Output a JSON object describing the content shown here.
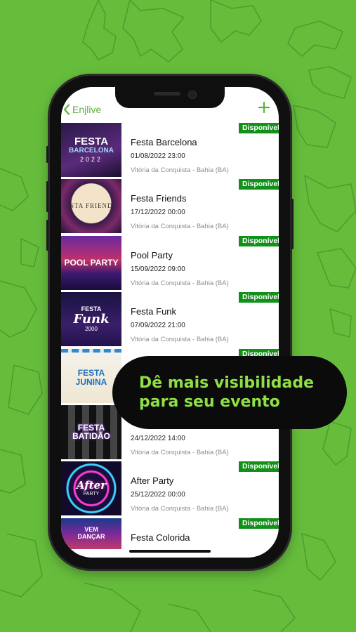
{
  "nav": {
    "back_label": "Enjlive"
  },
  "events": [
    {
      "title": "Festa Barcelona",
      "date": "01/08/2022 23:00",
      "location": "Vitória da Conquista - Bahia (BA)",
      "badge": "Disponível",
      "thumb": [
        "FESTA",
        "BARCELONA",
        "2022"
      ]
    },
    {
      "title": "Festa Friends",
      "date": "17/12/2022 00:00",
      "location": "Vitória da Conquista - Bahia (BA)",
      "badge": "Disponível",
      "thumb": [
        "ESTA FRIENDS",
        "",
        ""
      ]
    },
    {
      "title": "Pool Party",
      "date": "15/09/2022 09:00",
      "location": "Vitória da Conquista - Bahia (BA)",
      "badge": "Disponível",
      "thumb": [
        "POOL PARTY",
        "",
        ""
      ]
    },
    {
      "title": "Festa Funk",
      "date": "07/09/2022 21:00",
      "location": "Vitória da Conquista - Bahia (BA)",
      "badge": "Disponível",
      "thumb": [
        "FESTA",
        "Funk",
        "2000"
      ]
    },
    {
      "title": "",
      "date": "",
      "location": "",
      "badge": "Disponível",
      "thumb": [
        "FESTA",
        "JUNINA",
        ""
      ]
    },
    {
      "title": "",
      "date": "24/12/2022 14:00",
      "location": "Vitória da Conquista - Bahia (BA)",
      "badge": "",
      "thumb": [
        "FESTA",
        "BATIDÃO",
        ""
      ]
    },
    {
      "title": "After Party",
      "date": "25/12/2022 00:00",
      "location": "Vitória da Conquista - Bahia (BA)",
      "badge": "Disponível",
      "thumb": [
        "After",
        "PARTY",
        ""
      ]
    },
    {
      "title": "Festa Colorida",
      "date": "",
      "location": "",
      "badge": "Disponível",
      "thumb": [
        "VEM",
        "DANÇAR",
        ""
      ]
    }
  ],
  "banner": {
    "line1": "Dê mais visibilidade",
    "line2": "para seu evento"
  },
  "colors": {
    "background": "#66bd3c",
    "accent": "#5cb33b",
    "badge": "#12901a",
    "banner_text": "#8fe046"
  },
  "icons": {
    "back": "chevron-left-icon",
    "add": "plus-icon"
  }
}
